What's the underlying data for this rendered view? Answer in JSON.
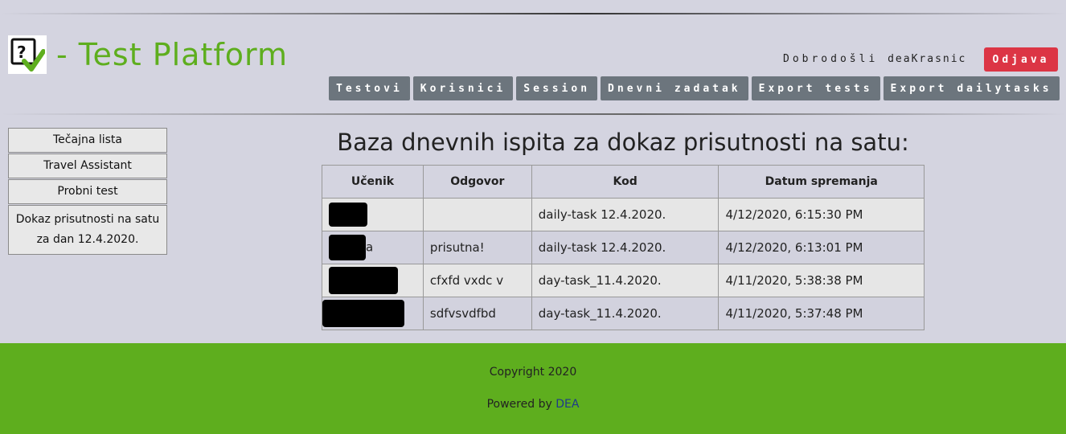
{
  "brand": {
    "title": "- Test Platform",
    "logo_icon": "question-check-logo-icon",
    "accent": "#5eae1e"
  },
  "header": {
    "welcome_label": "Dobrodošli",
    "username": "deaKrasnic",
    "logout_label": "Odjava",
    "logout_color": "#dc3545"
  },
  "nav": {
    "items": [
      {
        "label": "Testovi"
      },
      {
        "label": "Korisnici"
      },
      {
        "label": "Session"
      },
      {
        "label": "Dnevni zadatak"
      },
      {
        "label": "Export tests"
      },
      {
        "label": "Export dailytasks"
      }
    ]
  },
  "sidebar": {
    "items": [
      {
        "label": "Tečajna lista"
      },
      {
        "label": "Travel Assistant"
      },
      {
        "label": "Probni test"
      },
      {
        "label": "Dokaz prisutnosti na satu za dan 12.4.2020."
      }
    ]
  },
  "main": {
    "title": "Baza dnevnih ispita za dokaz prisutnosti na satu:",
    "table": {
      "headers": [
        "Učenik",
        "Odgovor",
        "Kod",
        "Datum spremanja"
      ],
      "rows": [
        {
          "student": "",
          "answer": "",
          "code": "daily-task 12.4.2020.",
          "date": "4/12/2020, 6:15:30 PM"
        },
        {
          "student": "a",
          "answer": "prisutna!",
          "code": "daily-task 12.4.2020.",
          "date": "4/12/2020, 6:13:01 PM"
        },
        {
          "student": "",
          "answer": "cfxfd vxdc v",
          "code": "day-task_11.4.2020.",
          "date": "4/11/2020, 5:38:38 PM"
        },
        {
          "student": "",
          "answer": "sdfvsvdfbd",
          "code": "day-task_11.4.2020.",
          "date": "4/11/2020, 5:37:48 PM"
        }
      ]
    }
  },
  "footer": {
    "copyright": "Copyright 2020",
    "powered_prefix": "Powered by",
    "powered_link": "DEA",
    "background": "#5eae1e"
  }
}
